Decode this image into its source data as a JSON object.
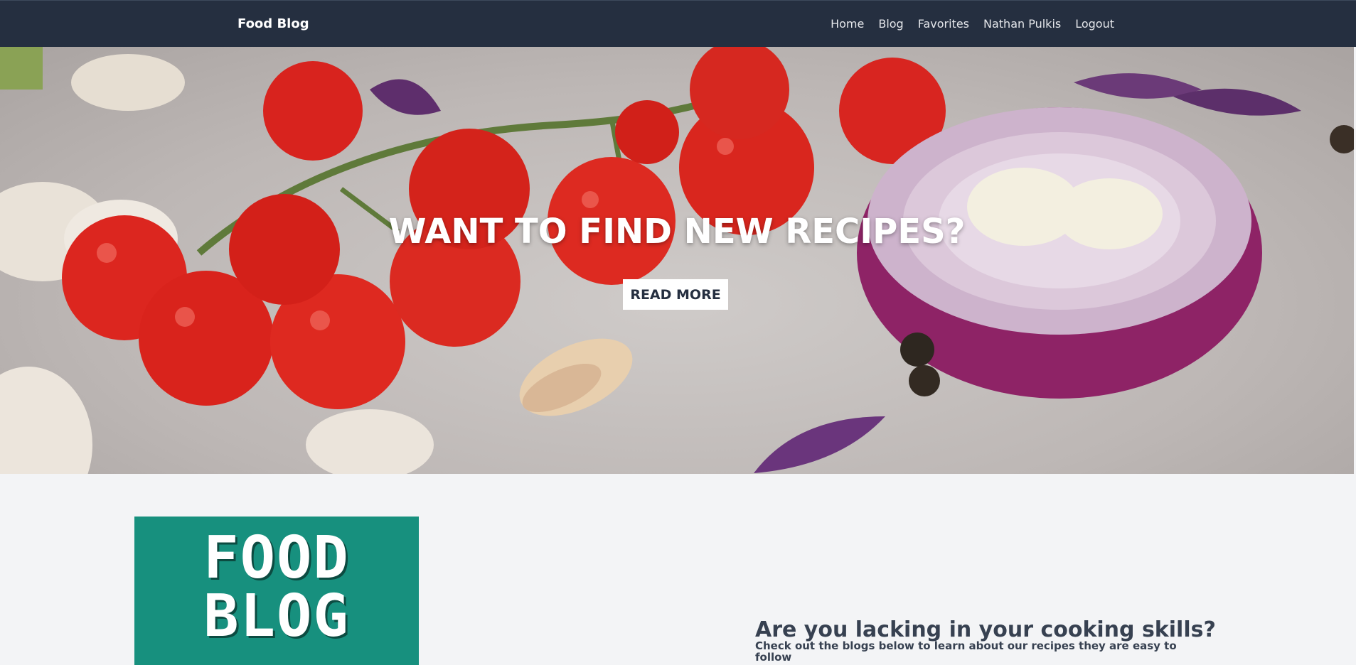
{
  "navbar": {
    "brand": "Food Blog",
    "links": [
      "Home",
      "Blog",
      "Favorites",
      "Nathan Pulkis",
      "Logout"
    ]
  },
  "hero": {
    "title": "WANT TO FIND NEW RECIPES?",
    "button_label": "READ MORE"
  },
  "blog_image": {
    "text_line1": "FOOD",
    "text_line2": "BLOG"
  },
  "section": {
    "heading": "Are you lacking in your cooking skills?",
    "subheading": "Check out the blogs below to learn about our recipes they are easy to follow"
  }
}
